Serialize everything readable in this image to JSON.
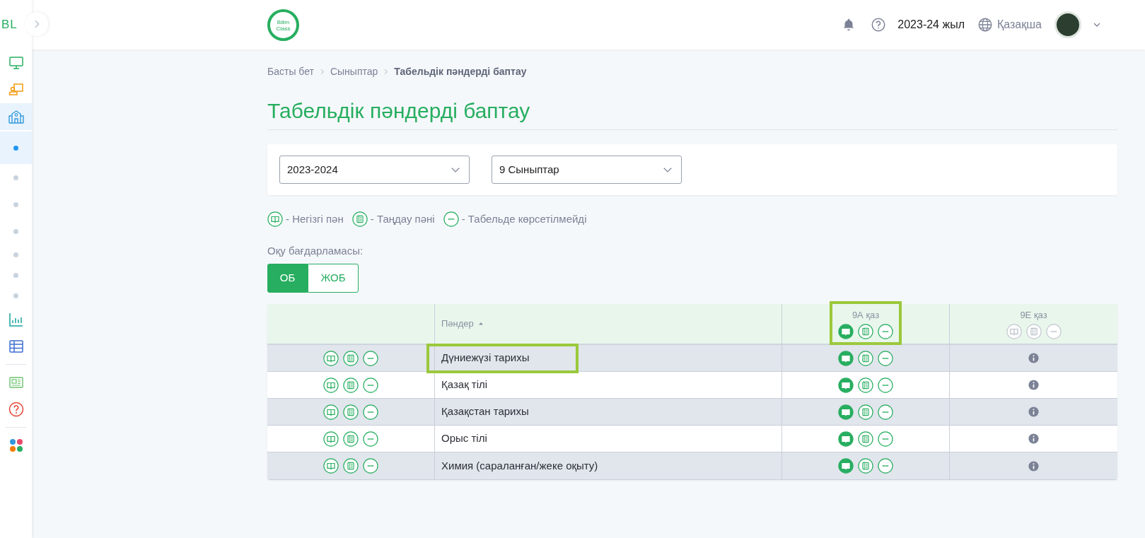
{
  "sidebar": {
    "logo": "BL",
    "groups": [
      [
        {
          "kind": "monitor",
          "selected": false
        },
        {
          "kind": "teacher",
          "selected": false
        },
        {
          "kind": "school",
          "selected": true,
          "expanded": true,
          "children": [
            {
              "selected": true
            },
            {
              "selected": false
            },
            {
              "selected": false
            },
            {
              "selected": false
            },
            {
              "selected": false
            },
            {
              "selected": false
            },
            {
              "selected": false
            }
          ]
        },
        {
          "kind": "chart",
          "selected": false
        },
        {
          "kind": "table",
          "selected": false
        }
      ],
      [
        {
          "kind": "news",
          "selected": false
        },
        {
          "kind": "help",
          "selected": false
        }
      ],
      [
        {
          "kind": "apps",
          "selected": false
        }
      ]
    ]
  },
  "header": {
    "logo_text": [
      "Bilim",
      "Class"
    ],
    "year": "2023-24 жыл",
    "language": "Қазақша"
  },
  "breadcrumb": [
    {
      "label": "Басты бет",
      "current": false
    },
    {
      "label": "Сыныптар",
      "current": false
    },
    {
      "label": "Табельдік пәндерді баптау",
      "current": true
    }
  ],
  "title": "Табельдік пәндерді баптау",
  "filters": [
    {
      "value": "2023-2024"
    },
    {
      "value": "9 Сыныптар"
    }
  ],
  "legend": [
    {
      "kind": "main",
      "label": "- Негізгі пән"
    },
    {
      "kind": "elective",
      "label": "- Таңдау пәні"
    },
    {
      "kind": "hidden",
      "label": "- Табельде көрсетілмейді"
    }
  ],
  "program": {
    "label": "Оқу бағдарламасы:",
    "options": [
      {
        "label": "ОБ",
        "selected": true
      },
      {
        "label": "ЖОБ",
        "selected": false
      }
    ]
  },
  "table": {
    "subject_header": "Пәндер",
    "classes": [
      {
        "label": "9А қаз",
        "disabled": false,
        "highlighted": true,
        "options": [
          {
            "kind": "main",
            "selected": true
          },
          {
            "kind": "elective",
            "selected": false
          },
          {
            "kind": "hidden",
            "selected": false
          }
        ]
      },
      {
        "label": "9Е қаз",
        "disabled": true,
        "highlighted": false,
        "options": [
          {
            "kind": "main",
            "selected": false
          },
          {
            "kind": "elective",
            "selected": false
          },
          {
            "kind": "hidden",
            "selected": false
          }
        ]
      }
    ],
    "rows": [
      {
        "name": "Дүниежүзі тарихы",
        "highlighted": true,
        "cells": [
          {
            "kind": "options",
            "options": [
              {
                "kind": "main",
                "selected": true
              },
              {
                "kind": "elective",
                "selected": false
              },
              {
                "kind": "hidden",
                "selected": false
              }
            ]
          },
          {
            "kind": "info"
          }
        ]
      },
      {
        "name": "Қазақ тілі",
        "highlighted": false,
        "cells": [
          {
            "kind": "options",
            "options": [
              {
                "kind": "main",
                "selected": true
              },
              {
                "kind": "elective",
                "selected": false
              },
              {
                "kind": "hidden",
                "selected": false
              }
            ]
          },
          {
            "kind": "info"
          }
        ]
      },
      {
        "name": "Қазақстан тарихы",
        "highlighted": false,
        "cells": [
          {
            "kind": "options",
            "options": [
              {
                "kind": "main",
                "selected": true
              },
              {
                "kind": "elective",
                "selected": false
              },
              {
                "kind": "hidden",
                "selected": false
              }
            ]
          },
          {
            "kind": "info"
          }
        ]
      },
      {
        "name": "Орыс тілі",
        "highlighted": false,
        "cells": [
          {
            "kind": "options",
            "options": [
              {
                "kind": "main",
                "selected": true
              },
              {
                "kind": "elective",
                "selected": false
              },
              {
                "kind": "hidden",
                "selected": false
              }
            ]
          },
          {
            "kind": "info"
          }
        ]
      },
      {
        "name": "Химия (сараланған/жеке оқыту)",
        "highlighted": false,
        "cells": [
          {
            "kind": "options",
            "options": [
              {
                "kind": "main",
                "selected": true
              },
              {
                "kind": "elective",
                "selected": false
              },
              {
                "kind": "hidden",
                "selected": false
              }
            ]
          },
          {
            "kind": "info"
          }
        ]
      }
    ]
  }
}
